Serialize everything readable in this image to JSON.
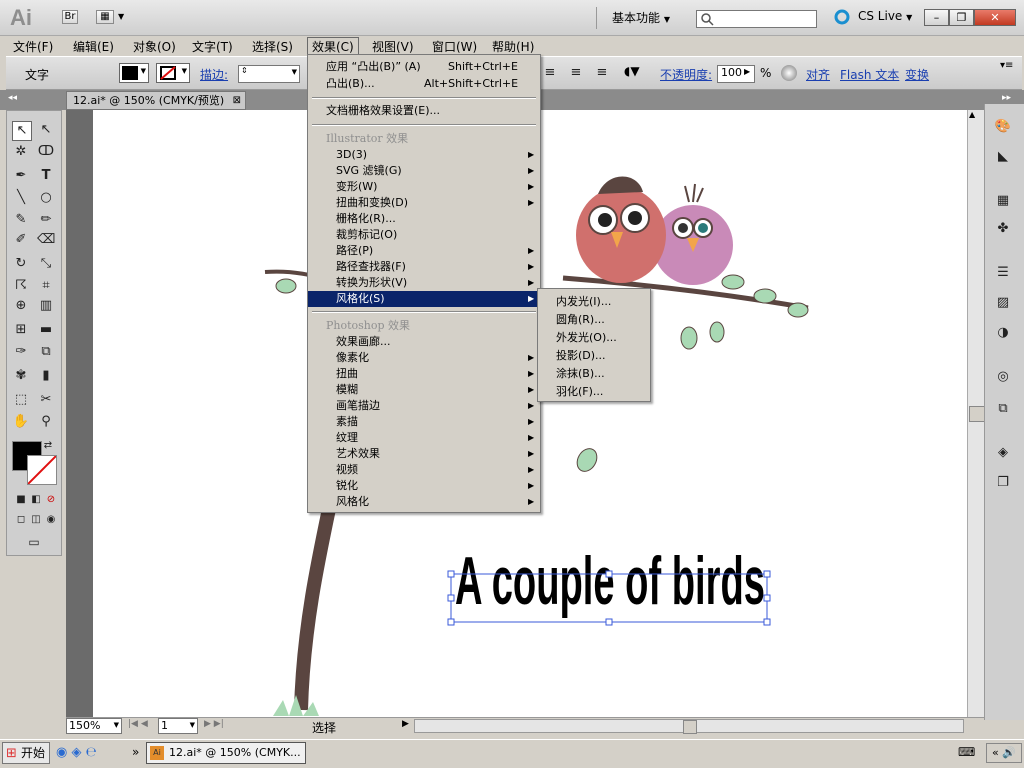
{
  "titlebar": {
    "app_logo": "Ai",
    "bridge_button": "Br",
    "workspace": "基本功能",
    "cs_live": "CS Live",
    "minimize": "–",
    "restore": "❐",
    "close": "✕"
  },
  "menubar": [
    "文件(F)",
    "编辑(E)",
    "对象(O)",
    "文字(T)",
    "选择(S)",
    "效果(C)",
    "视图(V)",
    "窗口(W)",
    "帮助(H)"
  ],
  "controlbar": {
    "tool_name": "文字",
    "stroke_label": "描边:",
    "opacity_label": "不透明度:",
    "opacity_value": "100",
    "opacity_unit": "%",
    "align_link": "对齐",
    "flash_text_link": "Flash 文本",
    "transform_link": "变换"
  },
  "document_tab": "12.ai* @ 150% (CMYK/预览)",
  "effect_menu": {
    "apply_last": "应用 “凸出(B)” (A)",
    "apply_last_shortcut": "Shift+Ctrl+E",
    "last_effect": "凸出(B)...",
    "last_effect_shortcut": "Alt+Shift+Ctrl+E",
    "raster_settings": "文档栅格效果设置(E)...",
    "illustrator_header": "Illustrator 效果",
    "illustrator_items": [
      "3D(3)",
      "SVG 滤镜(G)",
      "变形(W)",
      "扭曲和变换(D)",
      "栅格化(R)...",
      "裁剪标记(O)",
      "路径(P)",
      "路径查找器(F)",
      "转换为形状(V)",
      "风格化(S)"
    ],
    "photoshop_header": "Photoshop 效果",
    "photoshop_items": [
      "效果画廊...",
      "像素化",
      "扭曲",
      "模糊",
      "画笔描边",
      "素描",
      "纹理",
      "艺术效果",
      "视频",
      "锐化",
      "风格化"
    ]
  },
  "stylize_submenu": [
    "内发光(I)...",
    "圆角(R)...",
    "外发光(O)...",
    "投影(D)...",
    "涂抹(B)...",
    "羽化(F)..."
  ],
  "artwork": {
    "text": "A couple of birds"
  },
  "statusbar": {
    "zoom": "150%",
    "page": "1",
    "status": "选择"
  },
  "taskbar": {
    "start": "开始",
    "window_item": "12.ai* @ 150% (CMYK..."
  },
  "colors": {
    "menu_highlight": "#0a246a",
    "bird_left": "#d0706d",
    "bird_right": "#c98ab8",
    "leaf": "#a9d9b4",
    "trunk": "#5a4540"
  }
}
